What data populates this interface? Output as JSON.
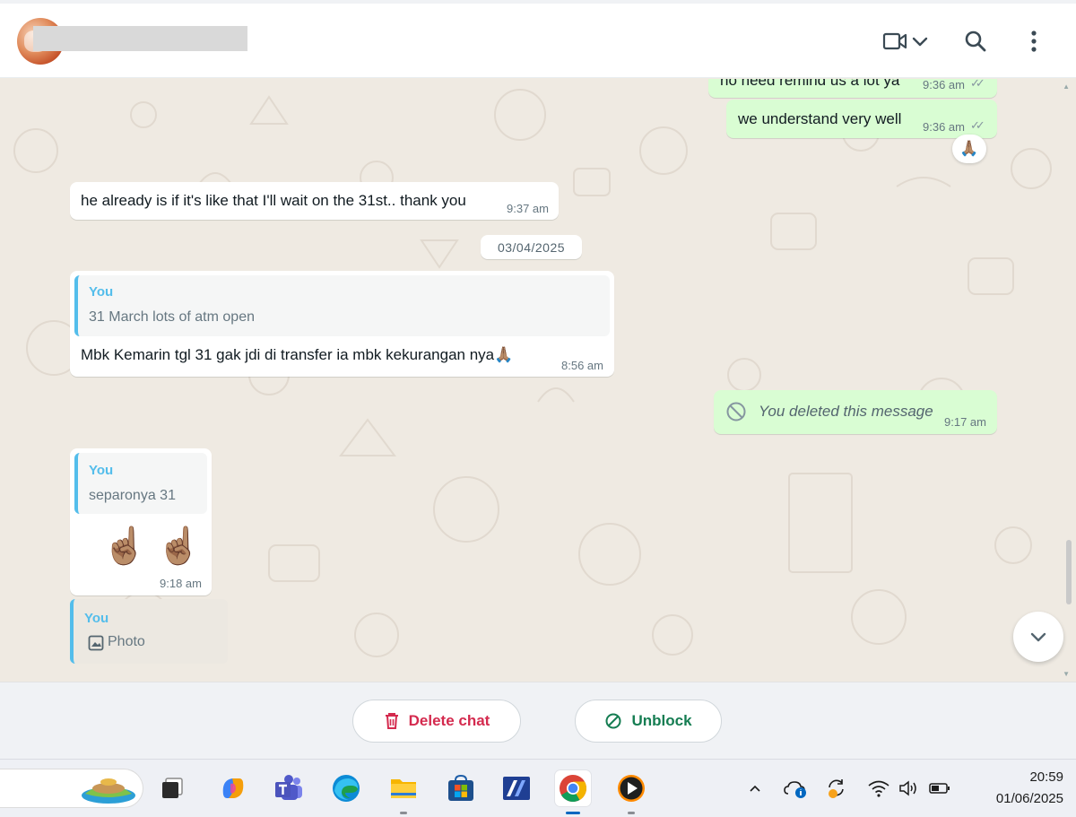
{
  "header": {
    "contact_name": "",
    "icons": [
      "video-call-icon",
      "chevron-down-icon",
      "search-icon",
      "more-options-icon"
    ]
  },
  "messages": [
    {
      "type": "outgoing",
      "text": "no need remind us a lot ya",
      "time": "9:36 am",
      "status": "read"
    },
    {
      "type": "outgoing",
      "text": "we understand very well",
      "time": "9:36 am",
      "status": "read",
      "reaction": "🙏🏽"
    },
    {
      "type": "incoming",
      "text": "he already is if it's like that I'll wait on the 31st.. thank you",
      "time": "9:37 am"
    },
    {
      "type": "date",
      "text": "03/04/2025"
    },
    {
      "type": "incoming",
      "quote_author": "You",
      "quote_text": "31 March lots of atm open",
      "text": "Mbk Kemarin tgl 31 gak jdi di transfer ia mbk kekurangan nya🙏🏽",
      "time": "8:56 am"
    },
    {
      "type": "outgoing",
      "deleted": true,
      "text": "You deleted this message",
      "time": "9:17 am"
    },
    {
      "type": "incoming",
      "quote_author": "You",
      "quote_text": "separonya 31",
      "text": "☝🏽 ☝🏽",
      "time": "9:18 am"
    },
    {
      "type": "incoming",
      "quote_author": "You",
      "quote_text": "Photo"
    }
  ],
  "footer": {
    "delete_label": "Delete chat",
    "unblock_label": "Unblock"
  },
  "taskbar": {
    "apps": [
      "widgets-icon",
      "task-view-icon",
      "copilot-icon",
      "teams-icon",
      "edge-icon",
      "file-explorer-icon",
      "microsoft-store-icon",
      "app-icon",
      "chrome-icon",
      "media-player-icon"
    ],
    "clock_time": "20:59",
    "clock_date": "01/06/2025"
  },
  "colors": {
    "outgoing_bubble": "#d9fdd3",
    "incoming_bubble": "#ffffff",
    "quote_accent": "#53bdeb",
    "delete_red": "#d42a4e",
    "unblock_green": "#157d52",
    "chat_bg": "#efeae2"
  }
}
